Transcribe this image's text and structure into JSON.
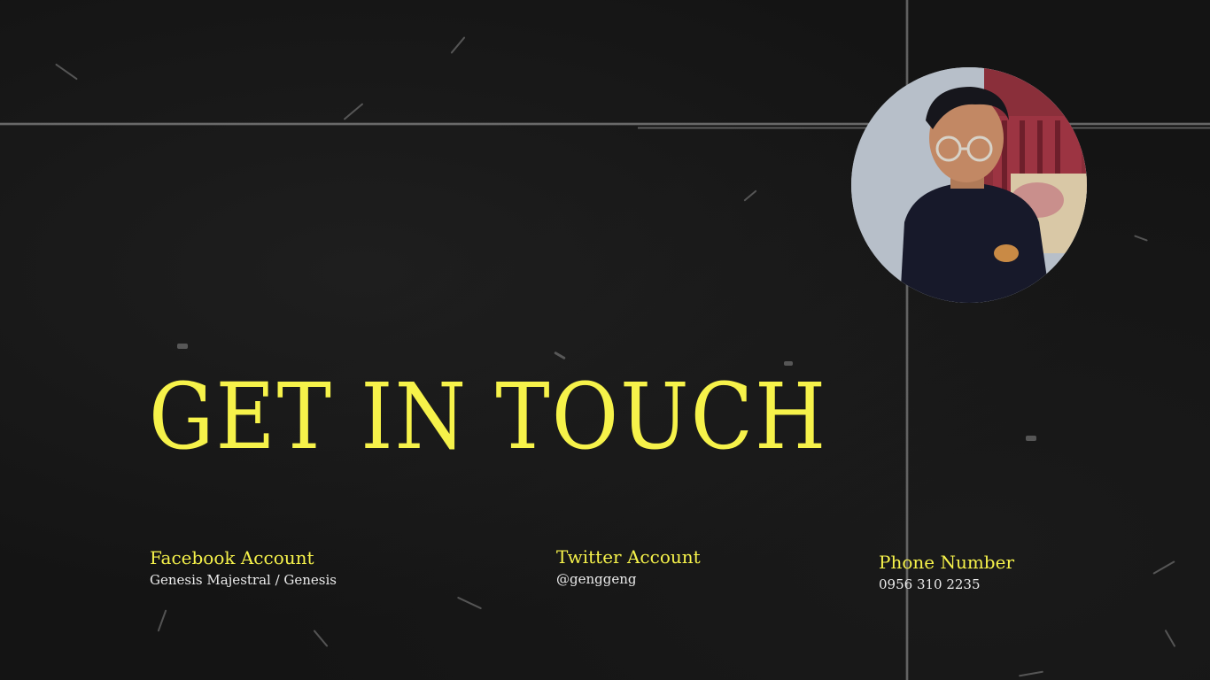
{
  "slide": {
    "title": "GET IN TOUCH",
    "accent_color": "#f6f24a",
    "background_color": "#141414",
    "photo_icon": "profile-photo"
  },
  "contacts": {
    "facebook": {
      "label": "Facebook Account",
      "value": "Genesis Majestral / Genesis"
    },
    "twitter": {
      "label": "Twitter Account",
      "value": "@genggeng"
    },
    "phone": {
      "label": "Phone Number",
      "value": "0956 310 2235"
    }
  }
}
